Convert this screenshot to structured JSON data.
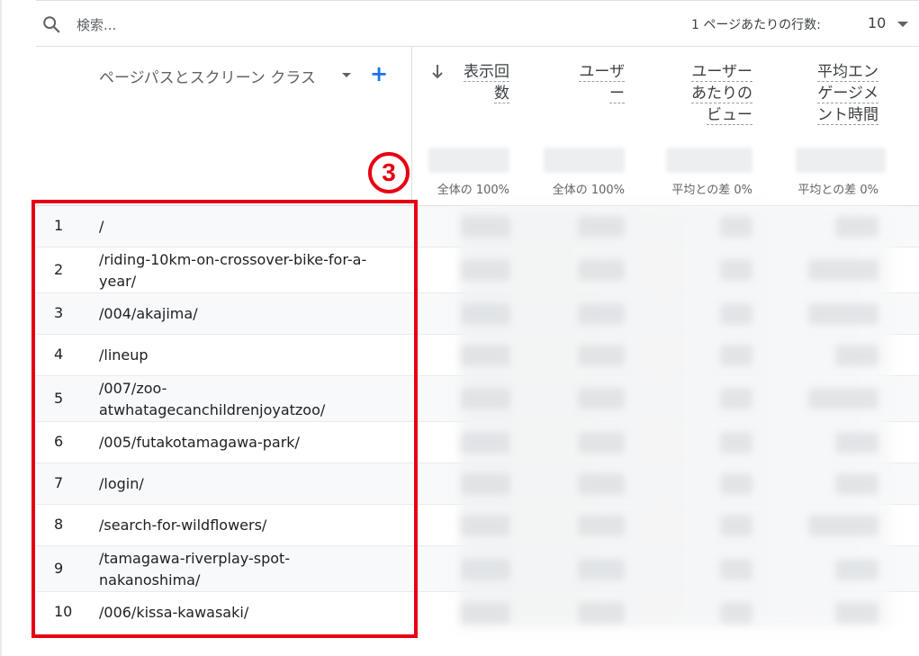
{
  "search": {
    "placeholder": "検索..."
  },
  "pagination": {
    "rows_label": "1 ページあたりの行数:",
    "rows_value": "10"
  },
  "table": {
    "dimension_header": "ページパスとスクリーン クラス",
    "metrics": [
      {
        "label": "表示回数",
        "total_pct": "全体の 100%"
      },
      {
        "label": "ユーザー",
        "total_pct": "全体の 100%"
      },
      {
        "label": "ユーザーあたりのビュー",
        "total_pct": "平均との差 0%"
      },
      {
        "label": "平均エンゲージメント時間",
        "total_pct": "平均との差 0%"
      }
    ],
    "rows": [
      {
        "num": "1",
        "path": "/"
      },
      {
        "num": "2",
        "path": "/riding-10km-on-crossover-bike-for-a-year/"
      },
      {
        "num": "3",
        "path": "/004/akajima/"
      },
      {
        "num": "4",
        "path": "/lineup"
      },
      {
        "num": "5",
        "path": "/007/zoo-atwhatagecanchildrenjoyatzoo/"
      },
      {
        "num": "6",
        "path": "/005/futakotamagawa-park/"
      },
      {
        "num": "7",
        "path": "/login/"
      },
      {
        "num": "8",
        "path": "/search-for-wildflowers/"
      },
      {
        "num": "9",
        "path": "/tamagawa-riverplay-spot-nakanoshima/"
      },
      {
        "num": "10",
        "path": "/006/kissa-kawasaki/"
      }
    ]
  },
  "annotation": {
    "callout_number": "3",
    "color": "#e60012"
  },
  "colors": {
    "accent": "#1a73e8",
    "highlight": "#e60012"
  }
}
